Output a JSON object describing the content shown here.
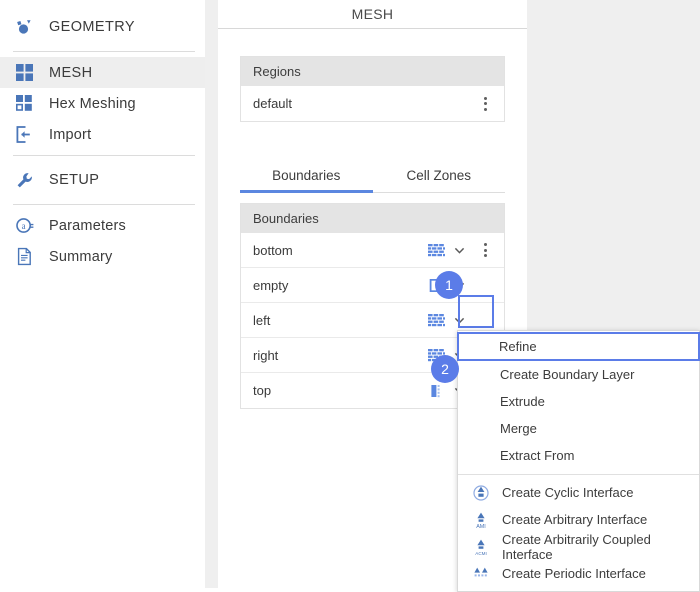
{
  "sidebar": {
    "groups": [
      {
        "items": [
          {
            "label": "GEOMETRY",
            "icon": "geometry-icon",
            "active": false,
            "section": true
          }
        ]
      },
      {
        "items": [
          {
            "label": "MESH",
            "icon": "mesh-grid-icon",
            "active": true,
            "section": false
          },
          {
            "label": "Hex Meshing",
            "icon": "hex-meshing-icon",
            "active": false,
            "section": false
          },
          {
            "label": "Import",
            "icon": "import-icon",
            "active": false,
            "section": false
          }
        ]
      },
      {
        "items": [
          {
            "label": "SETUP",
            "icon": "wrench-icon",
            "active": false,
            "section": true
          }
        ]
      },
      {
        "items": [
          {
            "label": "Parameters",
            "icon": "at-sign-icon",
            "active": false,
            "section": false
          },
          {
            "label": "Summary",
            "icon": "document-icon",
            "active": false,
            "section": false
          }
        ]
      }
    ]
  },
  "content": {
    "title": "MESH",
    "regions": {
      "header": "Regions",
      "rows": [
        {
          "label": "default",
          "kebab": true
        }
      ]
    },
    "tabs": [
      {
        "label": "Boundaries",
        "active": true
      },
      {
        "label": "Cell Zones",
        "active": false
      }
    ],
    "boundaries": {
      "header": "Boundaries",
      "rows": [
        {
          "label": "bottom",
          "type_icon": "wall-brick-icon"
        },
        {
          "label": "empty",
          "type_icon": "empty-square-icon"
        },
        {
          "label": "left",
          "type_icon": "wall-brick-icon"
        },
        {
          "label": "right",
          "type_icon": "wall-brick-icon"
        },
        {
          "label": "top",
          "type_icon": "patch-bar-icon"
        }
      ]
    }
  },
  "menu": {
    "items": [
      {
        "label": "Refine",
        "highlighted": true,
        "icon": null
      },
      {
        "label": "Create Boundary Layer",
        "highlighted": false,
        "icon": null
      },
      {
        "label": "Extrude",
        "highlighted": false,
        "icon": null
      },
      {
        "label": "Merge",
        "highlighted": false,
        "icon": null
      },
      {
        "label": "Extract From",
        "highlighted": false,
        "icon": null
      }
    ],
    "interface_items": [
      {
        "label": "Create Cyclic Interface",
        "icon": "cyclic-interface-icon",
        "icon_text": ""
      },
      {
        "label": "Create Arbitrary Interface",
        "icon": "ami-interface-icon",
        "icon_text": "AMI"
      },
      {
        "label": "Create Arbitrarily Coupled Interface",
        "icon": "acmi-interface-icon",
        "icon_text": "ACMI"
      },
      {
        "label": "Create Periodic Interface",
        "icon": "periodic-interface-icon",
        "icon_text": ""
      }
    ]
  },
  "annotations": {
    "badges": [
      {
        "number": "1"
      },
      {
        "number": "2"
      }
    ]
  },
  "colors": {
    "accent_blue": "#5b7ce8",
    "tab_underline": "#5b87e0",
    "icon_blue": "#4a76b8",
    "header_gray": "#e4e4e4"
  }
}
